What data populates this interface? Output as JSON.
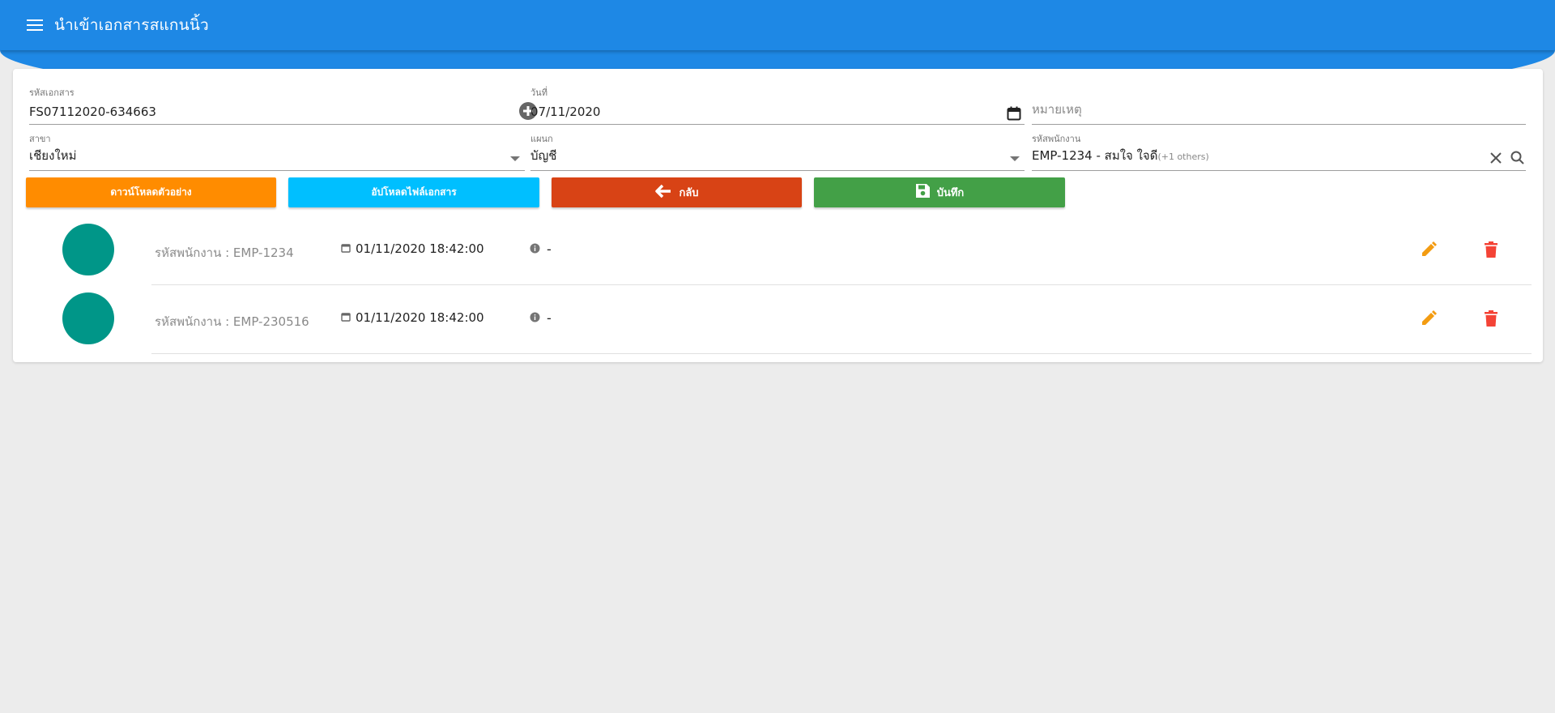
{
  "header": {
    "title": "นำเข้าเอกสารสแกนนิ้ว",
    "menu_icon": "menu-icon"
  },
  "form": {
    "doc_code": {
      "label": "รหัสเอกสาร",
      "value": "FS07112020-634663"
    },
    "date": {
      "label": "วันที่",
      "value": "07/11/2020"
    },
    "remark": {
      "placeholder": "หมายเหตุ"
    },
    "branch": {
      "label": "สาขา",
      "value": "เชียงใหม่"
    },
    "department": {
      "label": "แผนก",
      "value": "บัญชี"
    },
    "employee": {
      "label": "รหัสพนักงาน",
      "value": "EMP-1234 - สมใจ ใจดี",
      "others": "(+1 others)"
    }
  },
  "buttons": {
    "download_sample": "ดาวน์โหลดตัวอย่าง",
    "upload_file": "อัปโหลดไฟล์เอกสาร",
    "back": "กลับ",
    "save": "บันทึก"
  },
  "colors": {
    "appbar": "#1e88e5",
    "download": "#ff8c00",
    "upload": "#00bfff",
    "back": "#d84315",
    "save": "#43a047",
    "avatar": "#009688",
    "edit": "#f39c12",
    "delete": "#f44336"
  },
  "records": [
    {
      "employee_id": "รหัสพนักงาน : EMP-1234",
      "datetime": "01/11/2020 18:42:00",
      "note": "-"
    },
    {
      "employee_id": "รหัสพนักงาน : EMP-230516",
      "datetime": "01/11/2020 18:42:00",
      "note": "-"
    }
  ]
}
